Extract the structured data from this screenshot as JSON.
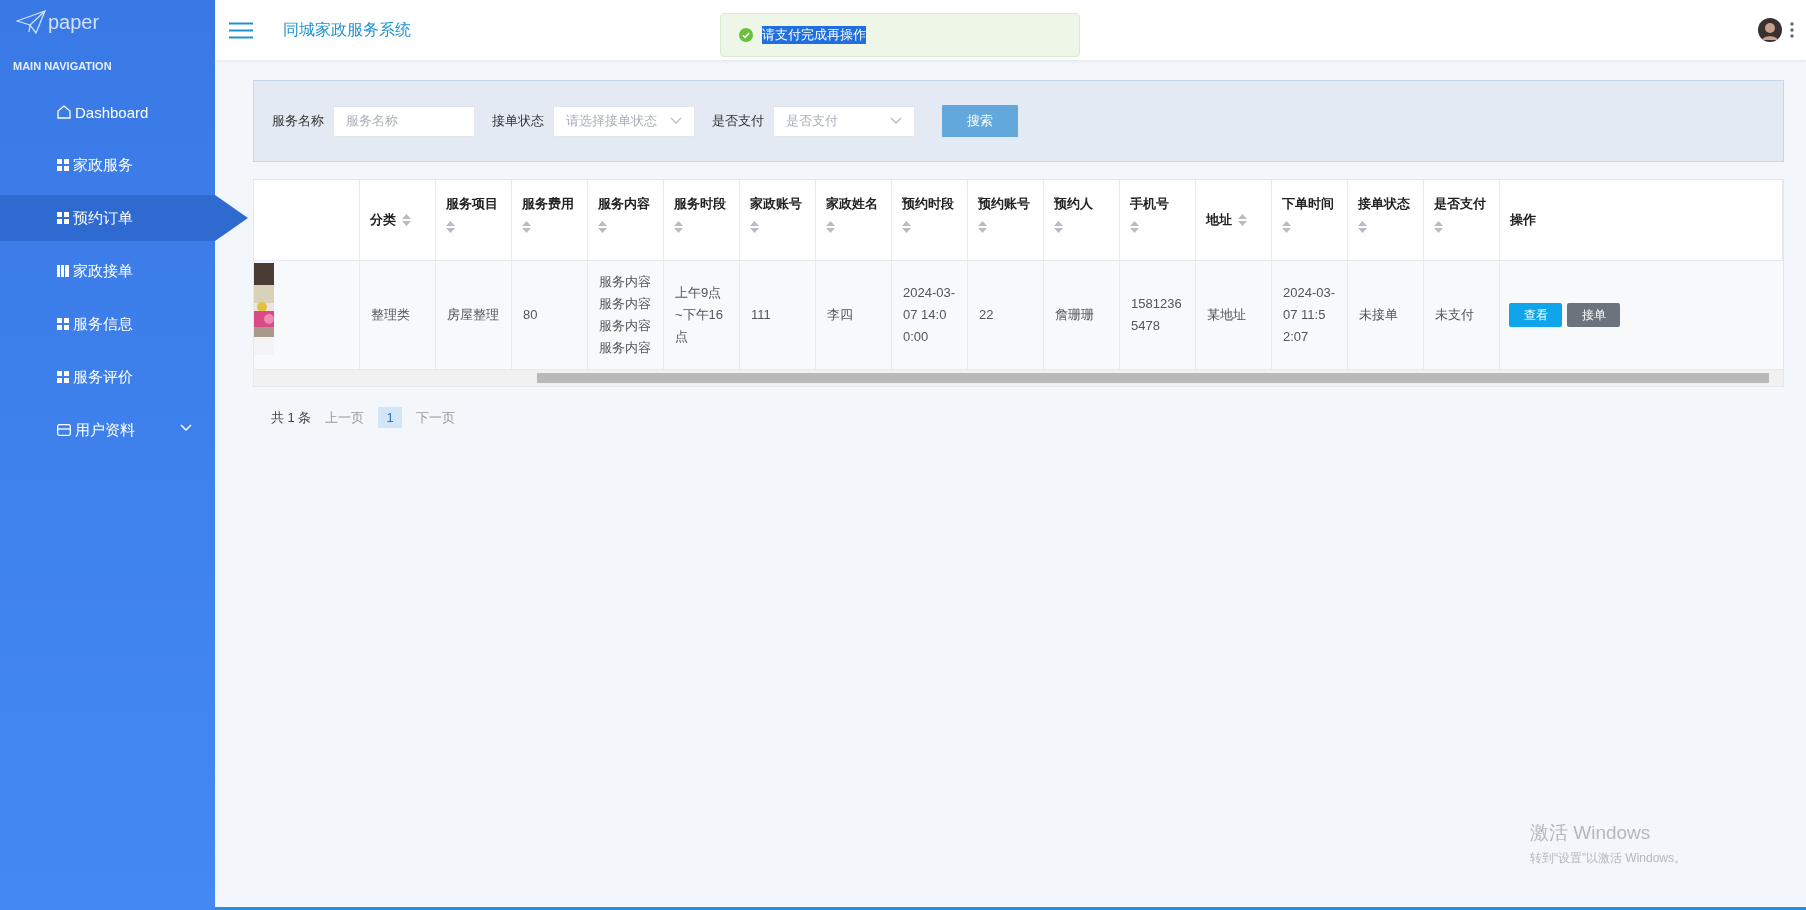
{
  "brand": "paper",
  "nav_heading": "MAIN NAVIGATION",
  "nav": [
    {
      "label": "Dashboard",
      "kind": "home",
      "selected": false,
      "expandable": false
    },
    {
      "label": "家政服务",
      "kind": "grid",
      "selected": false,
      "expandable": false
    },
    {
      "label": "预约订单",
      "kind": "grid",
      "selected": true,
      "expandable": false
    },
    {
      "label": "家政接单",
      "kind": "book",
      "selected": false,
      "expandable": false
    },
    {
      "label": "服务信息",
      "kind": "grid",
      "selected": false,
      "expandable": false
    },
    {
      "label": "服务评价",
      "kind": "grid",
      "selected": false,
      "expandable": false
    },
    {
      "label": "用户资料",
      "kind": "card",
      "selected": false,
      "expandable": true
    }
  ],
  "header": {
    "title": "同城家政服务系统"
  },
  "toast": {
    "message": "请支付完成再操作",
    "highlighted": true
  },
  "search": {
    "fields": [
      {
        "label": "服务名称",
        "kind": "input",
        "placeholder": "服务名称"
      },
      {
        "label": "接单状态",
        "kind": "select",
        "placeholder": "请选择接单状态"
      },
      {
        "label": "是否支付",
        "kind": "select",
        "placeholder": "是否支付"
      }
    ],
    "button": "搜索"
  },
  "table": {
    "columns": [
      {
        "label": "分类",
        "kind": "sort_inline"
      },
      {
        "label": "服务项目",
        "kind": "sort_below"
      },
      {
        "label": "服务费用",
        "kind": "sort_below"
      },
      {
        "label": "服务内容",
        "kind": "sort_below"
      },
      {
        "label": "服务时段",
        "kind": "sort_below"
      },
      {
        "label": "家政账号",
        "kind": "sort_below"
      },
      {
        "label": "家政姓名",
        "kind": "sort_below"
      },
      {
        "label": "预约时段",
        "kind": "sort_below"
      },
      {
        "label": "预约账号",
        "kind": "sort_below"
      },
      {
        "label": "预约人",
        "kind": "sort_below"
      },
      {
        "label": "手机号",
        "kind": "sort_below"
      },
      {
        "label": "地址",
        "kind": "sort_inline"
      },
      {
        "label": "下单时间",
        "kind": "sort_below"
      },
      {
        "label": "接单状态",
        "kind": "sort_below"
      },
      {
        "label": "是否支付",
        "kind": "sort_below"
      },
      {
        "label": "操作",
        "kind": "plain"
      }
    ],
    "rows": [
      {
        "image": {
          "kind": "picture"
        },
        "cells": [
          "整理类",
          "房屋整理",
          "80",
          "服务内容服务内容服务内容服务内容",
          "上午9点~下午16点",
          "111",
          "李四",
          "2024-03-07 14:00:00",
          "22",
          "詹珊珊",
          "15812365478",
          "某地址",
          "2024-03-07 11:52:07",
          "未接单",
          "未支付"
        ],
        "actions": [
          {
            "label": "查看",
            "kind": "primary"
          },
          {
            "label": "接单",
            "kind": "secondary"
          }
        ]
      }
    ]
  },
  "pagination": {
    "total": "共 1 条",
    "prev": "上一页",
    "pages": [
      {
        "label": "1",
        "selected": true
      }
    ],
    "next": "下一页"
  },
  "os_notice": [
    "激活 Windows",
    "转到“设置”以激活 Windows。"
  ]
}
